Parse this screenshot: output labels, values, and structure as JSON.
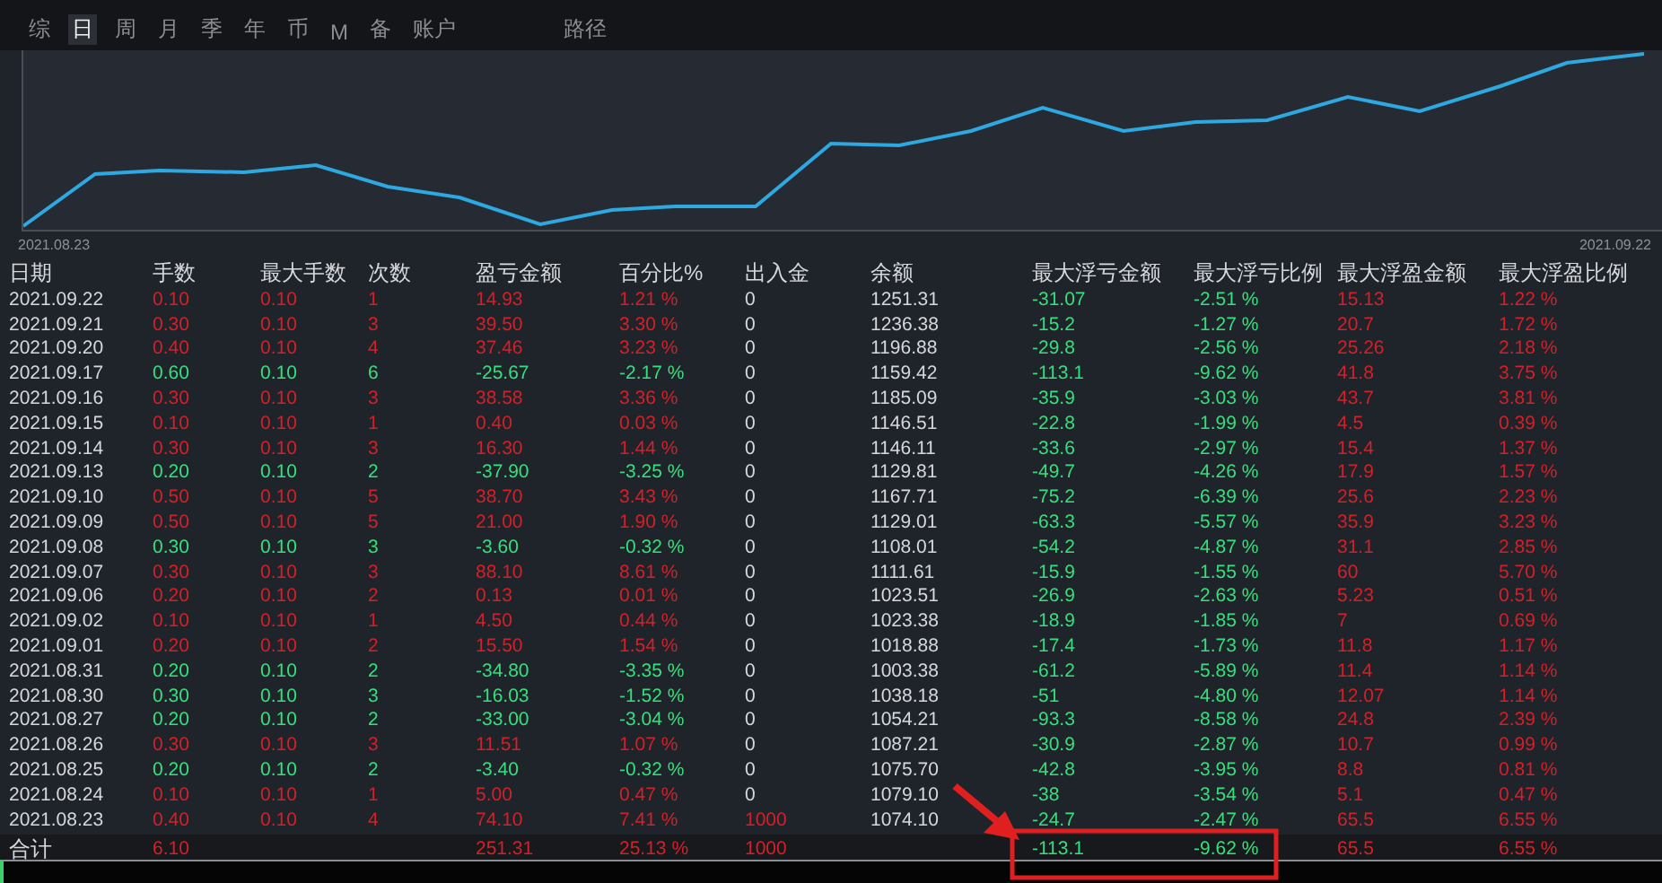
{
  "tabs": [
    {
      "label": "综",
      "selected": false
    },
    {
      "label": "日",
      "selected": true
    },
    {
      "label": "周",
      "selected": false
    },
    {
      "label": "月",
      "selected": false
    },
    {
      "label": "季",
      "selected": false
    },
    {
      "label": "年",
      "selected": false
    },
    {
      "label": "币",
      "selected": false
    },
    {
      "label": "M",
      "selected": false
    },
    {
      "label": "备",
      "selected": false
    },
    {
      "label": "账户",
      "selected": false
    }
  ],
  "path_label": "路径",
  "chart": {
    "start_label": "2021.08.23",
    "end_label": "2021.09.22"
  },
  "table": {
    "columns": [
      "日期",
      "手数",
      "最大手数",
      "次数",
      "盈亏金额",
      "百分比%",
      "出入金",
      "余额",
      "最大浮亏金额",
      "最大浮亏比例",
      "最大浮盈金额",
      "最大浮盈比例"
    ],
    "rows": [
      {
        "loss": false,
        "deposit_marked": false,
        "cells": [
          "2021.09.22",
          "0.10",
          "0.10",
          "1",
          "14.93",
          "1.21 %",
          "0",
          "1251.31",
          "-31.07",
          "-2.51 %",
          "15.13",
          "1.22 %"
        ]
      },
      {
        "loss": false,
        "deposit_marked": false,
        "cells": [
          "2021.09.21",
          "0.30",
          "0.10",
          "3",
          "39.50",
          "3.30 %",
          "0",
          "1236.38",
          "-15.2",
          "-1.27 %",
          "20.7",
          "1.72 %"
        ]
      },
      {
        "loss": false,
        "deposit_marked": false,
        "cells": [
          "2021.09.20",
          "0.40",
          "0.10",
          "4",
          "37.46",
          "3.23 %",
          "0",
          "1196.88",
          "-29.8",
          "-2.56 %",
          "25.26",
          "2.18 %"
        ]
      },
      {
        "loss": true,
        "deposit_marked": false,
        "cells": [
          "2021.09.17",
          "0.60",
          "0.10",
          "6",
          "-25.67",
          "-2.17 %",
          "0",
          "1159.42",
          "-113.1",
          "-9.62 %",
          "41.8",
          "3.75 %"
        ]
      },
      {
        "loss": false,
        "deposit_marked": false,
        "cells": [
          "2021.09.16",
          "0.30",
          "0.10",
          "3",
          "38.58",
          "3.36 %",
          "0",
          "1185.09",
          "-35.9",
          "-3.03 %",
          "43.7",
          "3.81 %"
        ]
      },
      {
        "loss": false,
        "deposit_marked": false,
        "cells": [
          "2021.09.15",
          "0.10",
          "0.10",
          "1",
          "0.40",
          "0.03 %",
          "0",
          "1146.51",
          "-22.8",
          "-1.99 %",
          "4.5",
          "0.39 %"
        ]
      },
      {
        "loss": false,
        "deposit_marked": false,
        "cells": [
          "2021.09.14",
          "0.30",
          "0.10",
          "3",
          "16.30",
          "1.44 %",
          "0",
          "1146.11",
          "-33.6",
          "-2.97 %",
          "15.4",
          "1.37 %"
        ]
      },
      {
        "loss": true,
        "deposit_marked": false,
        "cells": [
          "2021.09.13",
          "0.20",
          "0.10",
          "2",
          "-37.90",
          "-3.25 %",
          "0",
          "1129.81",
          "-49.7",
          "-4.26 %",
          "17.9",
          "1.57 %"
        ]
      },
      {
        "loss": false,
        "deposit_marked": false,
        "cells": [
          "2021.09.10",
          "0.50",
          "0.10",
          "5",
          "38.70",
          "3.43 %",
          "0",
          "1167.71",
          "-75.2",
          "-6.39 %",
          "25.6",
          "2.23 %"
        ]
      },
      {
        "loss": false,
        "deposit_marked": false,
        "cells": [
          "2021.09.09",
          "0.50",
          "0.10",
          "5",
          "21.00",
          "1.90 %",
          "0",
          "1129.01",
          "-63.3",
          "-5.57 %",
          "35.9",
          "3.23 %"
        ]
      },
      {
        "loss": true,
        "deposit_marked": false,
        "cells": [
          "2021.09.08",
          "0.30",
          "0.10",
          "3",
          "-3.60",
          "-0.32 %",
          "0",
          "1108.01",
          "-54.2",
          "-4.87 %",
          "31.1",
          "2.85 %"
        ]
      },
      {
        "loss": false,
        "deposit_marked": false,
        "cells": [
          "2021.09.07",
          "0.30",
          "0.10",
          "3",
          "88.10",
          "8.61 %",
          "0",
          "1111.61",
          "-15.9",
          "-1.55 %",
          "60",
          "5.70 %"
        ]
      },
      {
        "loss": false,
        "deposit_marked": false,
        "cells": [
          "2021.09.06",
          "0.20",
          "0.10",
          "2",
          "0.13",
          "0.01 %",
          "0",
          "1023.51",
          "-26.9",
          "-2.63 %",
          "5.23",
          "0.51 %"
        ]
      },
      {
        "loss": false,
        "deposit_marked": false,
        "cells": [
          "2021.09.02",
          "0.10",
          "0.10",
          "1",
          "4.50",
          "0.44 %",
          "0",
          "1023.38",
          "-18.9",
          "-1.85 %",
          "7",
          "0.69 %"
        ]
      },
      {
        "loss": false,
        "deposit_marked": false,
        "cells": [
          "2021.09.01",
          "0.20",
          "0.10",
          "2",
          "15.50",
          "1.54 %",
          "0",
          "1018.88",
          "-17.4",
          "-1.73 %",
          "11.8",
          "1.17 %"
        ]
      },
      {
        "loss": true,
        "deposit_marked": false,
        "cells": [
          "2021.08.31",
          "0.20",
          "0.10",
          "2",
          "-34.80",
          "-3.35 %",
          "0",
          "1003.38",
          "-61.2",
          "-5.89 %",
          "11.4",
          "1.14 %"
        ]
      },
      {
        "loss": true,
        "deposit_marked": false,
        "cells": [
          "2021.08.30",
          "0.30",
          "0.10",
          "3",
          "-16.03",
          "-1.52 %",
          "0",
          "1038.18",
          "-51",
          "-4.80 %",
          "12.07",
          "1.14 %"
        ]
      },
      {
        "loss": true,
        "deposit_marked": false,
        "cells": [
          "2021.08.27",
          "0.20",
          "0.10",
          "2",
          "-33.00",
          "-3.04 %",
          "0",
          "1054.21",
          "-93.3",
          "-8.58 %",
          "24.8",
          "2.39 %"
        ]
      },
      {
        "loss": false,
        "deposit_marked": false,
        "cells": [
          "2021.08.26",
          "0.30",
          "0.10",
          "3",
          "11.51",
          "1.07 %",
          "0",
          "1087.21",
          "-30.9",
          "-2.87 %",
          "10.7",
          "0.99 %"
        ]
      },
      {
        "loss": true,
        "deposit_marked": false,
        "cells": [
          "2021.08.25",
          "0.20",
          "0.10",
          "2",
          "-3.40",
          "-0.32 %",
          "0",
          "1075.70",
          "-42.8",
          "-3.95 %",
          "8.8",
          "0.81 %"
        ]
      },
      {
        "loss": false,
        "deposit_marked": false,
        "cells": [
          "2021.08.24",
          "0.10",
          "0.10",
          "1",
          "5.00",
          "0.47 %",
          "0",
          "1079.10",
          "-38",
          "-3.54 %",
          "5.1",
          "0.47 %"
        ]
      },
      {
        "loss": false,
        "deposit_marked": true,
        "cells": [
          "2021.08.23",
          "0.40",
          "0.10",
          "4",
          "74.10",
          "7.41 %",
          "1000",
          "1074.10",
          "-24.7",
          "-2.47 %",
          "65.5",
          "6.55 %"
        ]
      }
    ],
    "total": {
      "label": "合计",
      "lots": "6.10",
      "profit": "251.31",
      "percent": "25.13 %",
      "deposit": "1000",
      "max_float_loss": "-113.1",
      "max_float_loss_ratio": "-9.62 %",
      "max_float_profit": "65.5",
      "max_float_profit_ratio": "6.55 %"
    }
  }
}
